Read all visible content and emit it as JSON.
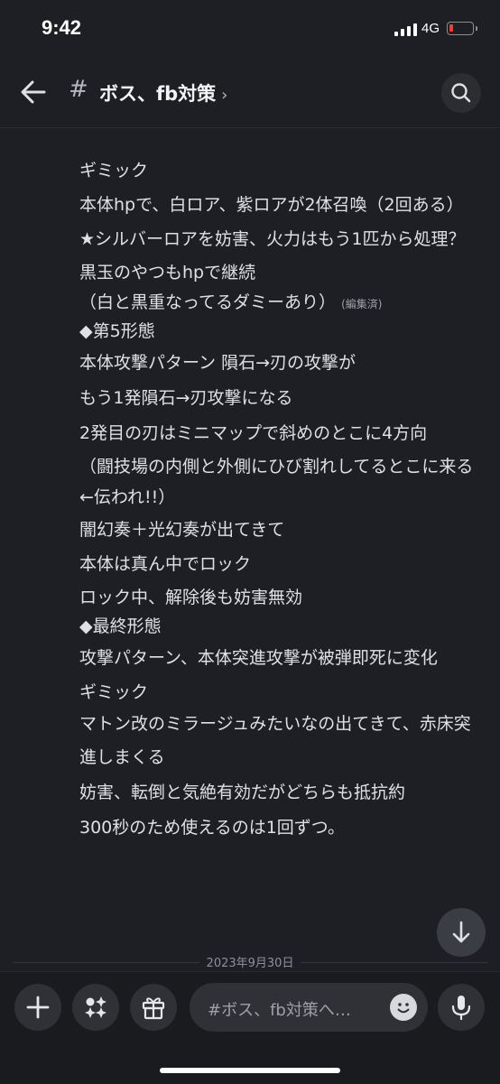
{
  "status_bar": {
    "time": "9:42",
    "network": "4G",
    "battery_level": 0.12
  },
  "header": {
    "channel_prefix": "#",
    "channel_name": "ボス、fb対策",
    "chevron": "›"
  },
  "messages": [
    "ギミック",
    "本体hpで、白ロア、紫ロアが2体召喚（2回ある）",
    "★シルバーロアを妨害、火力はもう1匹から処理？",
    "黒玉のやつもhpで継続",
    "（白と黒重なってるダミーあり）",
    "◆第5形態",
    "本体攻撃パターン 隕石→刃の攻撃が",
    "もう1発隕石→刃攻撃になる",
    "2発目の刃はミニマップで斜めのとこに4方向",
    "（闘技場の内側と外側にひび割れしてるとこに来る←伝われ!!）",
    "闇幻奏＋光幻奏が出てきて",
    "本体は真ん中でロック",
    "ロック中、解除後も妨害無効",
    "◆最終形態",
    "攻撃パターン、本体突進攻撃が被弾即死に変化",
    "ギミック",
    "マトン改のミラージュみたいなの出てきて、赤床突進しまくる",
    "妨害、転倒と気絶有効だがどちらも抵抗約",
    "300秒のため使えるのは1回ずつ。"
  ],
  "edited_label": "(編集済)",
  "date_divider": "2023年9月30日",
  "composer": {
    "placeholder": "#ボス、fb対策へ…"
  },
  "icons": {
    "back": "arrow-left-icon",
    "search": "search-icon",
    "jump": "arrow-down-icon",
    "add": "plus-icon",
    "apps": "apps-sparkle-icon",
    "gift": "gift-icon",
    "emoji": "emoji-icon",
    "mic": "microphone-icon"
  },
  "colors": {
    "background": "#1e1f24",
    "text": "#dfe0e4",
    "muted": "#9ea0a8",
    "battery_low": "#ff3b30"
  }
}
